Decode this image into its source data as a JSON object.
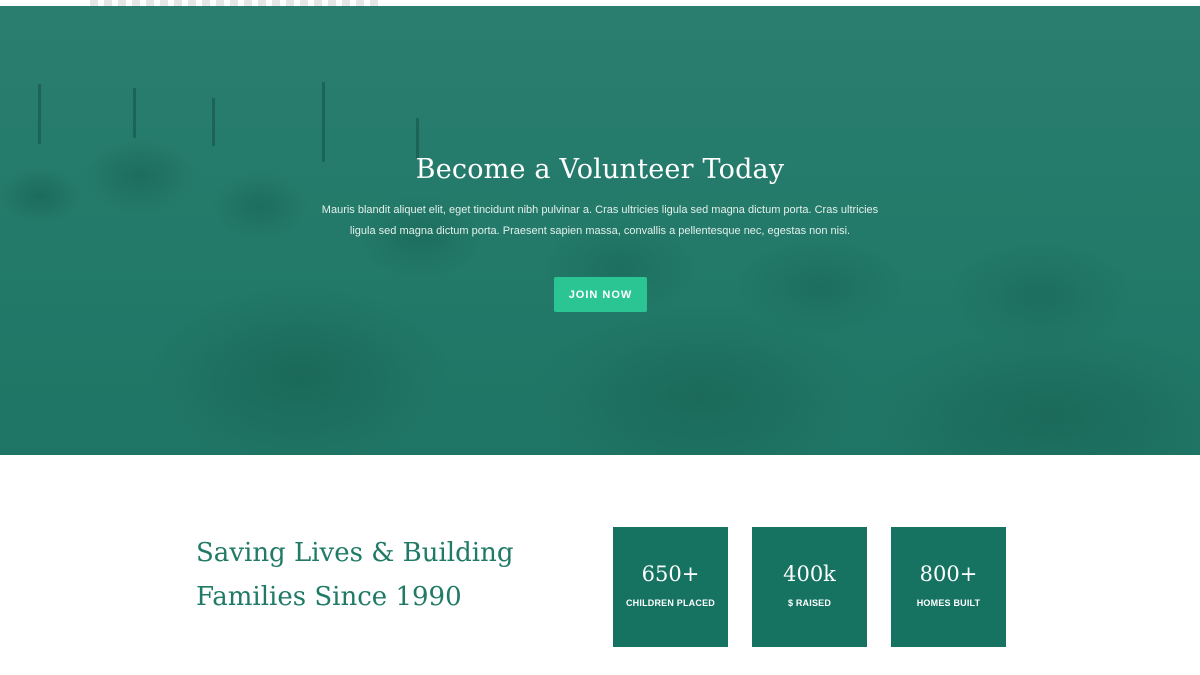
{
  "hero": {
    "title": "Become a Volunteer Today",
    "text": "Mauris blandit aliquet elit, eget tincidunt nibh pulvinar a. Cras ultricies ligula sed magna dictum porta. Cras ultricies ligula sed magna dictum porta. Praesent sapien massa, convallis a pellentesque nec, egestas non nisi.",
    "cta_label": "JOIN NOW",
    "overlay_color": "#237a69",
    "cta_color": "#2bc594"
  },
  "about": {
    "heading": "Saving Lives & Building Families Since 1990",
    "heading_color": "#1f7a66"
  },
  "stats": [
    {
      "value": "650+",
      "label": "CHILDREN PLACED"
    },
    {
      "value": "400k",
      "label": "$ RAISED"
    },
    {
      "value": "800+",
      "label": "HOMES BUILT"
    }
  ],
  "stat_card_color": "#167362"
}
